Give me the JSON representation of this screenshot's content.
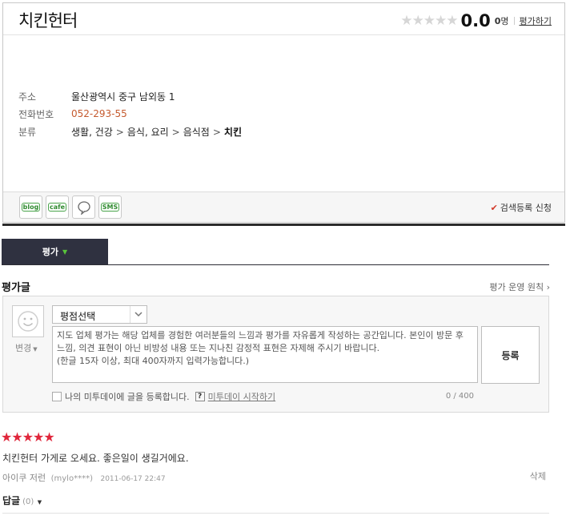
{
  "place": {
    "name": "치킨헌터",
    "rating": {
      "stars_empty": "★★★★★",
      "score": "0.0",
      "count": "0",
      "count_unit": "명",
      "rate_link": "평가하기"
    },
    "info": {
      "address_label": "주소",
      "address": "울산광역시 중구 남외동 1",
      "phone_label": "전화번호",
      "phone": "052-293-55",
      "category_label": "분류",
      "categories": [
        "생활, 건강",
        "음식, 요리",
        "음식점",
        "치킨"
      ],
      "category_sep": ">"
    },
    "share": {
      "blog": "blog",
      "cafe": "cafe",
      "sms": "SMS"
    },
    "report": "검색등록 신청"
  },
  "tabs": {
    "active": "평가"
  },
  "reviews": {
    "title": "평가글",
    "policy": "평가 운영 원칙",
    "write": {
      "change": "변경",
      "rate_select": "평점선택",
      "placeholder": "지도 업체 평가는 해당 업체를 경험한 여러분들의 느낌과 평가를 자유롭게 작성하는 공간입니다. 본인이 방문 후 느낌, 의견 표현이 아닌 비방성 내용 또는 지나친 감정적 표현은 자제해 주시기 바랍니다.\n(한글 15자 이상, 최대 400자까지 입력가능합니다.)",
      "submit": "등록",
      "me2day_checkbox": "나의 미투데이에 글을 등록합니다.",
      "me2day_q": "?",
      "me2day_link": "미투데이 시작하기",
      "counter": "0 / 400"
    },
    "items": [
      {
        "stars": "★★★★★",
        "rating": 5,
        "text": "치킨헌터 가게로 오세요. 좋은일이 생길거에요.",
        "author": "아이쿠 저런",
        "uid": "(mylo****)",
        "date": "2011-06-17 22:47",
        "delete": "삭제",
        "reply_label": "답글",
        "reply_count": "(0)"
      }
    ]
  },
  "colors": {
    "accent_green": "#58c43a",
    "star_red": "#e0263b",
    "tab_dark": "#2f3140",
    "phone": "#c55a2e"
  }
}
